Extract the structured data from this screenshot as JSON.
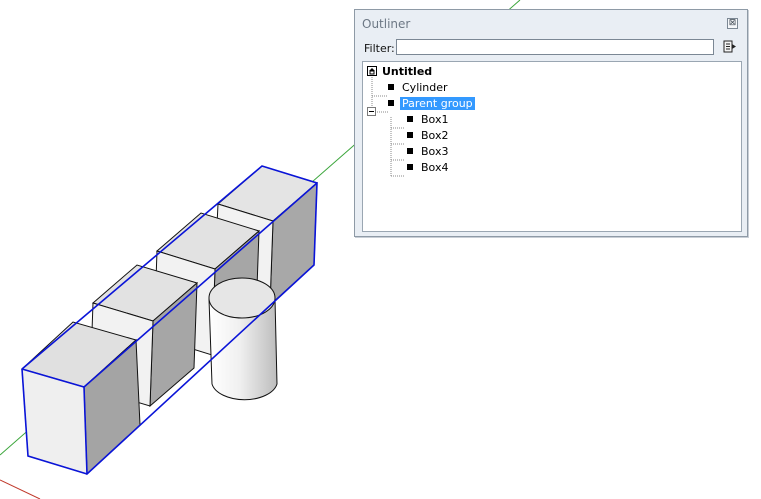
{
  "outliner": {
    "title": "Outliner",
    "close_glyph": "⊠",
    "filter_label": "Filter:",
    "filter_value": "",
    "detail_button_icon": "details-arrow-icon",
    "model_icon": "model-house-icon",
    "tree": {
      "root": "Untitled",
      "items": [
        {
          "label": "Cylinder",
          "icon": "component-square-icon"
        },
        {
          "label": "Parent group",
          "icon": "group-square-icon",
          "expanded": true,
          "selected": true,
          "children": [
            {
              "label": "Box1",
              "icon": "component-square-icon"
            },
            {
              "label": "Box2",
              "icon": "component-square-icon"
            },
            {
              "label": "Box3",
              "icon": "component-square-icon"
            },
            {
              "label": "Box4",
              "icon": "component-square-icon"
            }
          ]
        }
      ]
    }
  },
  "viewport": {
    "axis_colors": {
      "green": "#3aa53a",
      "red": "#c0392b"
    },
    "selection_color": "#0a14d8"
  }
}
